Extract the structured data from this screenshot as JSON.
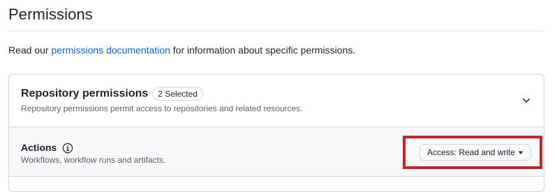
{
  "page": {
    "title": "Permissions"
  },
  "intro": {
    "prefix": "Read our ",
    "link_text": "permissions documentation",
    "suffix": " for information about specific permissions."
  },
  "repository_permissions": {
    "title": "Repository permissions",
    "badge": "2 Selected",
    "description": "Repository permissions permit access to repositories and related resources."
  },
  "actions": {
    "title": "Actions",
    "description": "Workflows, workflow runs and artifacts.",
    "access_label": "Access: Read and write"
  },
  "colors": {
    "link": "#0969da",
    "highlight": "#c4252a",
    "row_bg": "#f6f8fa",
    "border": "#d0d7de"
  },
  "icons": [
    "chevron-down-icon",
    "info-icon",
    "caret-down-icon"
  ]
}
